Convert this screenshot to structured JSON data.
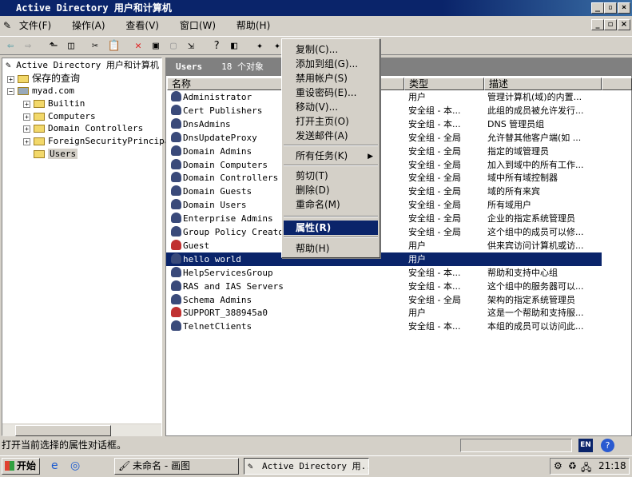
{
  "window": {
    "title": "Active Directory 用户和计算机"
  },
  "menu": [
    "文件(F)",
    "操作(A)",
    "查看(V)",
    "窗口(W)",
    "帮助(H)"
  ],
  "tree": {
    "root": "Active Directory 用户和计算机",
    "items": [
      {
        "label": "保存的查询",
        "level": 1
      },
      {
        "label": "myad.com",
        "level": 1
      },
      {
        "label": "Builtin",
        "level": 2
      },
      {
        "label": "Computers",
        "level": 2
      },
      {
        "label": "Domain Controllers",
        "level": 2
      },
      {
        "label": "ForeignSecurityPrincipals",
        "level": 2
      },
      {
        "label": "Users",
        "level": 2,
        "selected": true
      }
    ]
  },
  "pane": {
    "title": "Users",
    "count": "18 个对象"
  },
  "columns": [
    "名称",
    "类型",
    "描述"
  ],
  "rows": [
    [
      "Administrator",
      "用户",
      "管理计算机(域)的内置..."
    ],
    [
      "Cert Publishers",
      "安全组 - 本...",
      "此组的成员被允许发行..."
    ],
    [
      "DnsAdmins",
      "安全组 - 本...",
      "DNS 管理员组"
    ],
    [
      "DnsUpdateProxy",
      "安全组 - 全局",
      "允许替其他客户端(如 ..."
    ],
    [
      "Domain Admins",
      "安全组 - 全局",
      "指定的域管理员"
    ],
    [
      "Domain Computers",
      "安全组 - 全局",
      "加入到域中的所有工作..."
    ],
    [
      "Domain Controllers",
      "安全组 - 全局",
      "域中所有域控制器"
    ],
    [
      "Domain Guests",
      "安全组 - 全局",
      "域的所有来宾"
    ],
    [
      "Domain Users",
      "安全组 - 全局",
      "所有域用户"
    ],
    [
      "Enterprise Admins",
      "安全组 - 全局",
      "企业的指定系统管理员"
    ],
    [
      "Group Policy Creator",
      "安全组 - 全局",
      "这个组中的成员可以修..."
    ],
    [
      "Guest",
      "用户",
      "供来宾访问计算机或访..."
    ],
    [
      "hello world",
      "用户",
      ""
    ],
    [
      "HelpServicesGroup",
      "安全组 - 本...",
      "帮助和支持中心组"
    ],
    [
      "RAS and IAS Servers",
      "安全组 - 本...",
      "这个组中的服务器可以..."
    ],
    [
      "Schema Admins",
      "安全组 - 全局",
      "架构的指定系统管理员"
    ],
    [
      "SUPPORT_388945a0",
      "用户",
      "这是一个帮助和支持服..."
    ],
    [
      "TelnetClients",
      "安全组 - 本...",
      "本组的成员可以访问此..."
    ]
  ],
  "context_menu": [
    "复制(C)...",
    "添加到组(G)...",
    "禁用帐户(S)",
    "重设密码(E)...",
    "移动(V)...",
    "打开主页(O)",
    "发送邮件(A)",
    "所有任务(K)",
    "剪切(T)",
    "删除(D)",
    "重命名(M)",
    "属性(R)",
    "帮助(H)"
  ],
  "status": "打开当前选择的属性对话框。",
  "taskbar": {
    "start": "开始",
    "tasks": [
      "未命名 - 画图",
      "Active Directory 用..."
    ],
    "lang": "EN",
    "clock": "21:18"
  }
}
